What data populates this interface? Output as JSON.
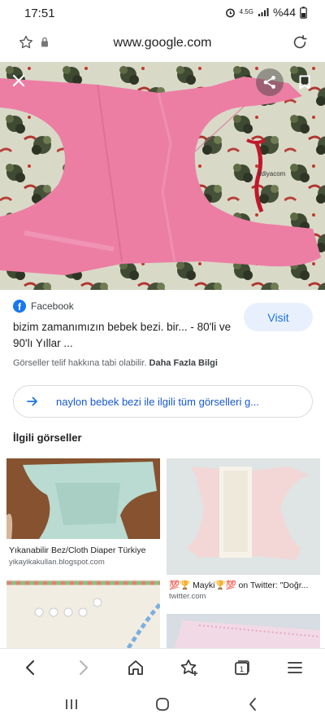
{
  "status": {
    "time": "17:51",
    "network": "4.5G",
    "battery": "%44"
  },
  "browser": {
    "url": "www.google.com"
  },
  "result": {
    "source": "Facebook",
    "visit_label": "Visit",
    "title": "bizim zamanımızın bebek bezi. bir... - 80'li ve 90'lı Yıllar ...",
    "copyright_note": "Görseller telif hakkına tabi olabilir.",
    "more_info": "Daha Fazla Bilgi",
    "related_search": "naylon bebek bezi ile ilgili tüm görselleri g..."
  },
  "related": {
    "heading": "İlgili görseller",
    "items": [
      {
        "caption": "Yıkanabilir Bez/Cloth Diaper Türkiye",
        "domain": "yikayikakullan.blogspot.com"
      },
      {
        "caption": "💯🏆 Mayki🏆💯 on Twitter: \"Doğr...",
        "domain": "twitter.com"
      },
      {
        "caption": "",
        "domain": ""
      },
      {
        "caption": "",
        "domain": ""
      }
    ]
  },
  "hero_image": {
    "watermark": "lidiyacom"
  },
  "bottom_nav": {
    "tab_count": "1"
  },
  "icons": {
    "close": "close-icon",
    "share": "share-icon",
    "bookmark": "bookmark-icon",
    "star": "star-icon",
    "lock": "lock-icon",
    "reload": "reload-icon",
    "back": "back-icon",
    "forward": "forward-icon",
    "home": "home-icon",
    "tabs": "tabs-icon",
    "menu": "menu-icon"
  },
  "colors": {
    "accent": "#1a73e8",
    "visit_bg": "#e8f0fe",
    "facebook": "#1877f2",
    "diaper_pink": "#ec7ea4"
  }
}
